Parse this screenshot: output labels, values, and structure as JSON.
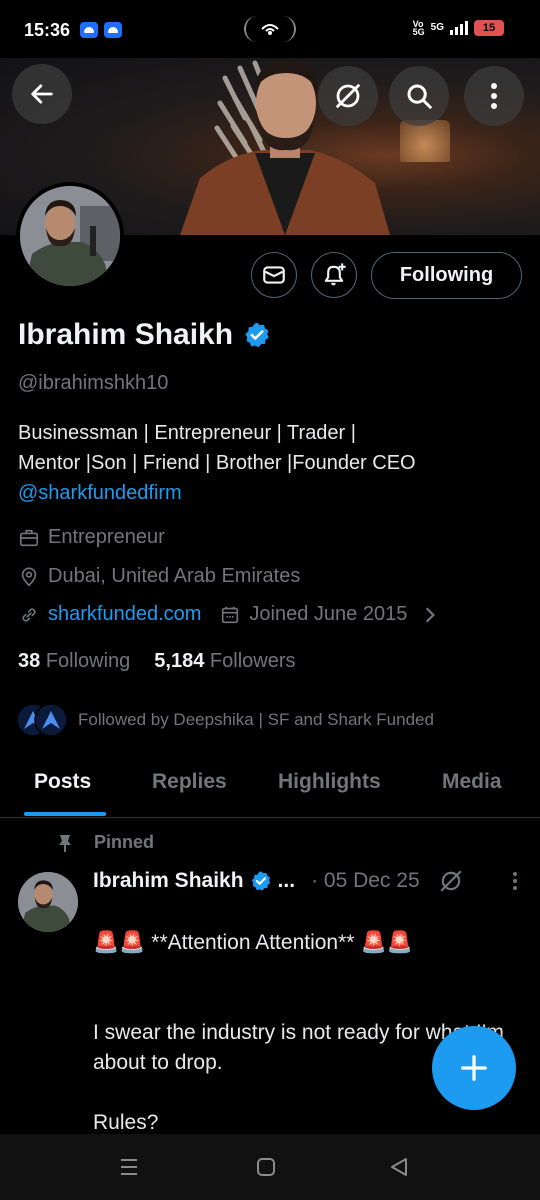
{
  "status_bar": {
    "time": "15:36",
    "network_top": "Vo",
    "network_bottom": "5G",
    "network_type": "5G",
    "battery": "15",
    "battery_color": "#e05252"
  },
  "header": {
    "back_icon": "arrow-left-icon",
    "grok_icon": "grok-icon",
    "search_icon": "search-icon",
    "more_icon": "more-vertical-icon"
  },
  "profile": {
    "name": "Ibrahim Shaikh",
    "handle": "@ibrahimshkh10",
    "verified_color": "#1d9bf0",
    "following_button": "Following",
    "bio_line1": "Businessman | Entrepreneur | Trader |",
    "bio_line2": "Mentor |Son | Friend | Brother |Founder CEO",
    "bio_mention": "@sharkfundedfirm",
    "category": "Entrepreneur",
    "location": "Dubai, United Arab Emirates",
    "website": "sharkfunded.com",
    "joined": "Joined June 2015",
    "following_count": "38",
    "following_label": "Following",
    "followers_count": "5,184",
    "followers_label": "Followers",
    "followed_by": "Followed by Deepshika | SF and Shark Funded"
  },
  "tabs": [
    {
      "label": "Posts",
      "active": true
    },
    {
      "label": "Replies",
      "active": false
    },
    {
      "label": "Highlights",
      "active": false
    },
    {
      "label": "Media",
      "active": false
    }
  ],
  "pinned_post": {
    "pinned_label": "Pinned",
    "author": "Ibrahim Shaikh",
    "ellipsis": "...",
    "date": "· 05 Dec 25",
    "line1": "**Attention Attention**",
    "body": "I swear the industry is not ready for what I’m about to drop.\n\nRules?\nRestrictions?\nDelays?"
  },
  "colors": {
    "accent": "#1d9bf0",
    "muted_text": "#71767b",
    "background": "#000000"
  }
}
